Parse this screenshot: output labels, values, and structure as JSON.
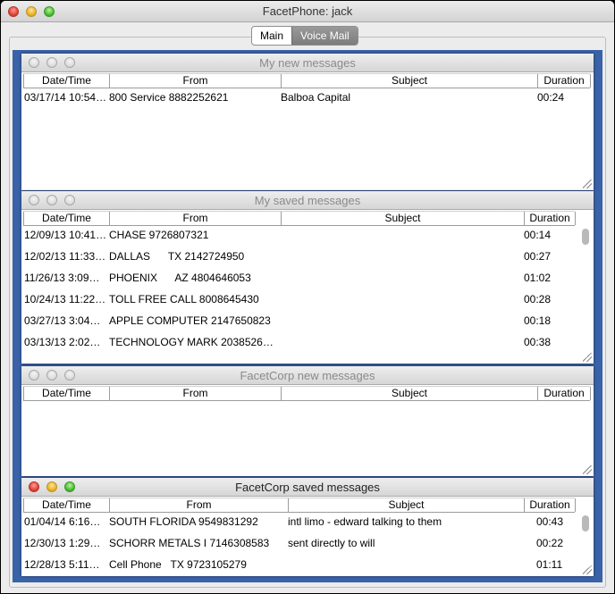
{
  "window": {
    "title": "FacetPhone: jack"
  },
  "tabs": [
    {
      "label": "Main"
    },
    {
      "label": "Voice Mail"
    }
  ],
  "columns": {
    "date": "Date/Time",
    "from": "From",
    "subject": "Subject",
    "duration": "Duration"
  },
  "panels": {
    "my_new": {
      "title": "My new messages",
      "rows": [
        {
          "date": "03/17/14 10:54…",
          "from": "800 Service 8882252621",
          "subject": "Balboa Capital",
          "duration": "00:24"
        }
      ]
    },
    "my_saved": {
      "title": "My saved messages",
      "rows": [
        {
          "date": "12/09/13 10:41…",
          "from": "CHASE 9726807321",
          "subject": "",
          "duration": "00:14"
        },
        {
          "date": "12/02/13 11:33…",
          "from": "DALLAS      TX 2142724950",
          "subject": "",
          "duration": "00:27"
        },
        {
          "date": "11/26/13 3:09…",
          "from": "PHOENIX      AZ 4804646053",
          "subject": "",
          "duration": "01:02"
        },
        {
          "date": "10/24/13 11:22…",
          "from": "TOLL FREE CALL 8008645430",
          "subject": "",
          "duration": "00:28"
        },
        {
          "date": "03/27/13 3:04…",
          "from": "APPLE COMPUTER 2147650823",
          "subject": "",
          "duration": "00:18"
        },
        {
          "date": "03/13/13 2:02…",
          "from": "TECHNOLOGY MARK 2038526…",
          "subject": "",
          "duration": "00:38"
        }
      ]
    },
    "corp_new": {
      "title": "FacetCorp new messages",
      "rows": []
    },
    "corp_saved": {
      "title": "FacetCorp saved messages",
      "rows": [
        {
          "date": "01/04/14 6:16…",
          "from": "SOUTH FLORIDA 9549831292",
          "subject": "intl limo - edward talking to them",
          "duration": "00:43"
        },
        {
          "date": "12/30/13 1:29…",
          "from": "SCHORR METALS I 7146308583",
          "subject": "sent directly to will",
          "duration": "00:22"
        },
        {
          "date": "12/28/13 5:11…",
          "from": "Cell Phone   TX 9723105279",
          "subject": "",
          "duration": "01:11"
        }
      ]
    }
  },
  "colors": {
    "desktop": "#3a62a8",
    "tab_active": "#8a8a8a"
  }
}
